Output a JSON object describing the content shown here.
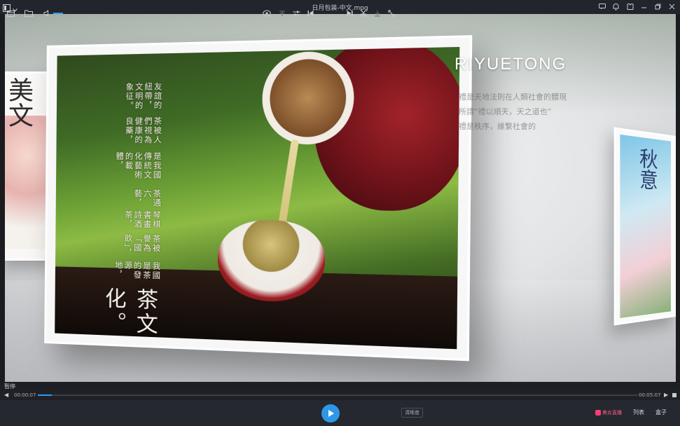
{
  "window": {
    "title": "日月包装-中文.mpg"
  },
  "video": {
    "brand_text": "RIYUETONG",
    "side_lines": [
      "禮是天地法則在人類社會的體現",
      "所謂“禮以順天，天之道也”",
      "禮是秩序，維繫社會的"
    ],
    "main_title": "茶文化。",
    "poem_lines": [
      "我國是茶的發源地，",
      "茶被譽為「國飲」，",
      "琴棋書畫詩酒茶，",
      "茶通六藝，",
      "是我國傳統文化藝術的載體，",
      "茶被人們視為健康的良藥，",
      "友誼的紐帶，文明的象征。"
    ],
    "left_panel_chars": "美文",
    "right_panel_chars": "秋意"
  },
  "status": {
    "text": "暂停"
  },
  "seek": {
    "current_time": "00:00:07",
    "total_time": "00:05:07",
    "progress_fraction": 0.023
  },
  "controls": {
    "clarity_label": "清晰度",
    "live_label": "美女直播",
    "list_label": "列表",
    "box_label": "盒子"
  },
  "colors": {
    "accent": "#2e98e8",
    "live": "#ff3d75",
    "bar_bg": "#25282e"
  }
}
